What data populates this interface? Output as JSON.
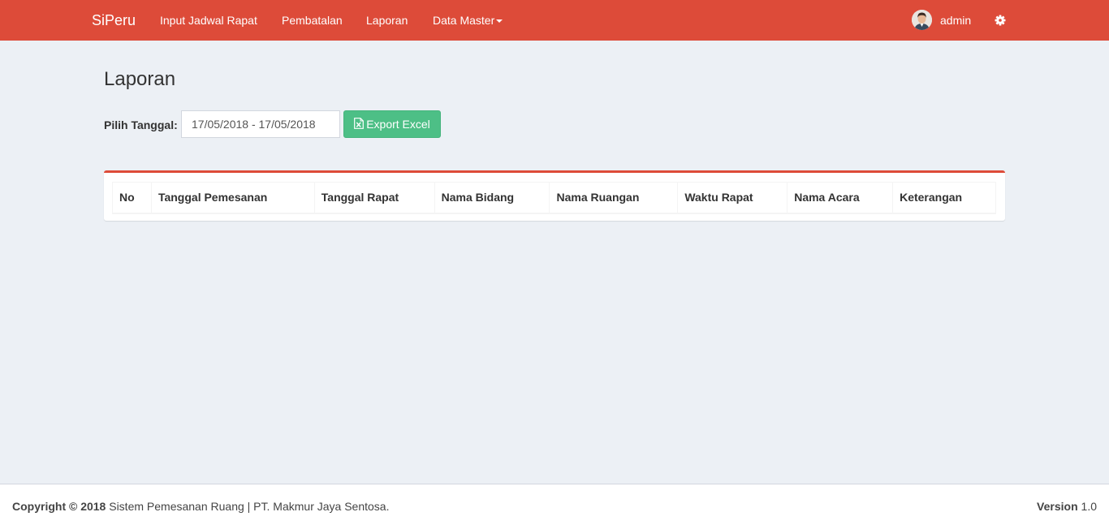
{
  "navbar": {
    "brand": "SiPeru",
    "links": [
      "Input Jadwal Rapat",
      "Pembatalan",
      "Laporan",
      "Data Master"
    ],
    "user": "admin",
    "color": "#dd4b39"
  },
  "page": {
    "title": "Laporan",
    "filter_label": "Pilih Tanggal:",
    "date_range": "17/05/2018 - 17/05/2018",
    "export_label": "Export Excel"
  },
  "table": {
    "columns": [
      "No",
      "Tanggal Pemesanan",
      "Tanggal Rapat",
      "Nama Bidang",
      "Nama Ruangan",
      "Waktu Rapat",
      "Nama Acara",
      "Keterangan"
    ]
  },
  "footer": {
    "copyright_bold": "Copyright © 2018",
    "copyright_text": " Sistem Pemesanan Ruang | PT. Makmur Jaya Sentosa.",
    "version_label": "Version",
    "version_value": " 1.0"
  },
  "icons": [
    "caret-down-icon",
    "user-avatar",
    "gear-icon",
    "file-excel-icon"
  ]
}
